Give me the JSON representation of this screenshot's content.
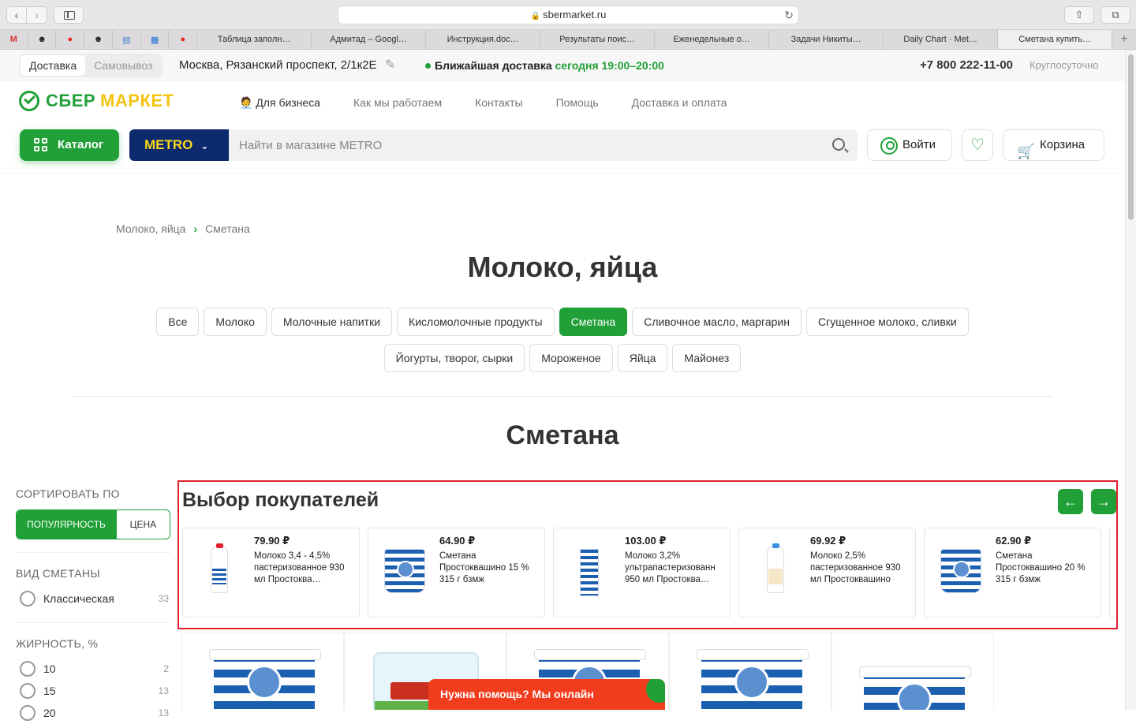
{
  "browser": {
    "url": "sbermarket.ru",
    "tabs": [
      "Таблица заполн…",
      "Адмитад – Googl…",
      "Инструкция.doc…",
      "Результаты поис…",
      "Еженедельные о…",
      "Задачи Никиты…",
      "Daily Chart · Met…",
      "Сметана купить…"
    ],
    "favicon_tabs": [
      "gmail-icon",
      "user-icon",
      "red-circle-icon",
      "user-icon",
      "docs-icon",
      "trello-icon",
      "red-circle-icon"
    ]
  },
  "topbar": {
    "mode_delivery": "Доставка",
    "mode_pickup": "Самовывоз",
    "address": "Москва, Рязанский проспект, 2/1к2Е",
    "nearest_label": "Ближайшая доставка",
    "nearest_time": "сегодня 19:00–20:00",
    "phone": "+7 800 222-11-00",
    "hours": "Круглосуточно"
  },
  "header": {
    "logo_left": "СБЕР",
    "logo_right": "МАРКЕТ",
    "nav": [
      "🧑‍💼 Для бизнеса",
      "Как мы работаем",
      "Контакты",
      "Помощь",
      "Доставка и оплата"
    ],
    "catalog": "Каталог",
    "store": "METRO",
    "search_placeholder": "Найти в магазине METRO",
    "login": "Войти",
    "cart": "Корзина"
  },
  "breadcrumb": {
    "parent": "Молоко, яйца",
    "current": "Сметана"
  },
  "category_title": "Молоко, яйца",
  "chips_row1": [
    "Все",
    "Молоко",
    "Молочные напитки",
    "Кисломолочные продукты",
    "Сметана",
    "Сливочное масло, маргарин",
    "Сгущенное молоко, сливки"
  ],
  "chips_row2": [
    "Йогурты, творог, сырки",
    "Мороженое",
    "Яйца",
    "Майонез"
  ],
  "active_chip": "Сметана",
  "section_title": "Сметана",
  "sidebar": {
    "sort_title": "СОРТИРОВАТЬ ПО",
    "sort_popular": "ПОПУЛЯРНОСТЬ",
    "sort_price": "ЦЕНА",
    "kind_title": "ВИД СМЕТАНЫ",
    "kinds": [
      {
        "label": "Классическая",
        "count": "33"
      }
    ],
    "fat_title": "ЖИРНОСТЬ, %",
    "fats": [
      {
        "label": "10",
        "count": "2"
      },
      {
        "label": "15",
        "count": "13"
      },
      {
        "label": "20",
        "count": "13"
      }
    ]
  },
  "carousel": {
    "title": "Выбор покупателей",
    "products": [
      {
        "price": "79.90 ₽",
        "name": "Молоко 3,4 - 4,5% пастеризованное 930 мл Простоква…",
        "thumb": "bottle"
      },
      {
        "price": "64.90 ₽",
        "name": "Сметана Простоквашино 15 % 315 г бзмж",
        "thumb": "cup"
      },
      {
        "price": "103.00 ₽",
        "name": "Молоко 3,2% ультрапастеризованн 950 мл Простоква…",
        "thumb": "pack"
      },
      {
        "price": "69.92 ₽",
        "name": "Молоко 2,5% пастеризованное 930 мл Простоквашино",
        "thumb": "bottle"
      },
      {
        "price": "62.90 ₽",
        "name": "Сметана Простоквашино 20 % 315 г бзмж",
        "thumb": "cup"
      }
    ]
  },
  "help_bar": "Нужна помощь? Мы онлайн"
}
